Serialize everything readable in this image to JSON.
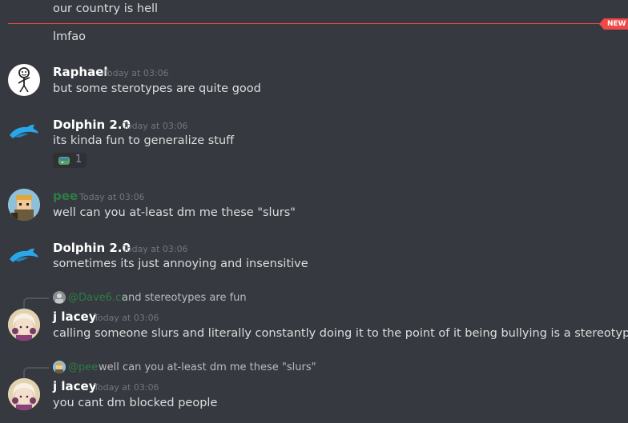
{
  "new_badge": "NEW",
  "messages": [
    {
      "text": "our country is hell"
    },
    {
      "text": "lmfao"
    },
    {
      "username": "Raphael",
      "timestamp": "Today at 03:06",
      "text": "but some sterotypes are quite good"
    },
    {
      "username": "Dolphin 2.0",
      "timestamp": "Today at 03:06",
      "text": "its kinda fun to generalize stuff",
      "reaction_count": "1"
    },
    {
      "username": "pee",
      "timestamp": "Today at 03:06",
      "text": "well can you at-least dm me these \"slurs\""
    },
    {
      "username": "Dolphin 2.0",
      "timestamp": "Today at 03:06",
      "text": "sometimes its just annoying and insensitive"
    },
    {
      "reply_name": "@Dave6.co",
      "reply_text": "and stereotypes are fun",
      "username": "j lacey",
      "timestamp": "Today at 03:06",
      "text": "calling someone slurs and literally constantly doing it to the point of it being bullying is a stereotype?"
    },
    {
      "reply_name": "@pee",
      "reply_text": "well can you at-least dm me these \"slurs\"",
      "username": "j lacey",
      "timestamp": "Today at 03:06",
      "text": "you cant dm blocked people"
    }
  ],
  "colors": {
    "divider": "#f04747",
    "pee_name": "#2d7d46",
    "background": "#36393f"
  },
  "icons": [
    "stickman-avatar",
    "dolphin-avatar",
    "pixel-character-avatar",
    "anime-girl-avatar",
    "reaction-emoji"
  ]
}
